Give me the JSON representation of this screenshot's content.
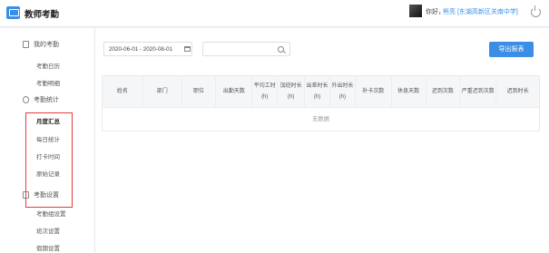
{
  "header": {
    "app_title": "教师考勤",
    "greeting": "你好，",
    "user": "熊亮 [东湖高新区关南中学]"
  },
  "sidebar": {
    "groups": [
      {
        "label": "我的考勤",
        "items": [
          "考勤日历",
          "考勤明细"
        ]
      },
      {
        "label": "考勤统计",
        "items": [
          "月度汇总",
          "每日统计",
          "打卡时间",
          "原始记录"
        ]
      },
      {
        "label": "考勤设置",
        "items": [
          "考勤组设置",
          "班次设置",
          "假期设置"
        ]
      }
    ],
    "active_item": "月度汇总"
  },
  "filters": {
    "date_range": "2020-06-01 - 2020-08-01",
    "search_placeholder": ""
  },
  "export_label": "导出报表",
  "table": {
    "columns": [
      "姓名",
      "部门",
      "职位",
      "出勤天数",
      "平均工时(h)",
      "加班时长(h)",
      "出差时长(h)",
      "外出时长(h)",
      "补卡次数",
      "休息天数",
      "迟到次数",
      "严重迟到次数",
      "迟到时长"
    ],
    "empty_text": "无数据"
  },
  "colors": {
    "accent": "#3a8ee6",
    "highlight_border": "#e53b3b"
  }
}
